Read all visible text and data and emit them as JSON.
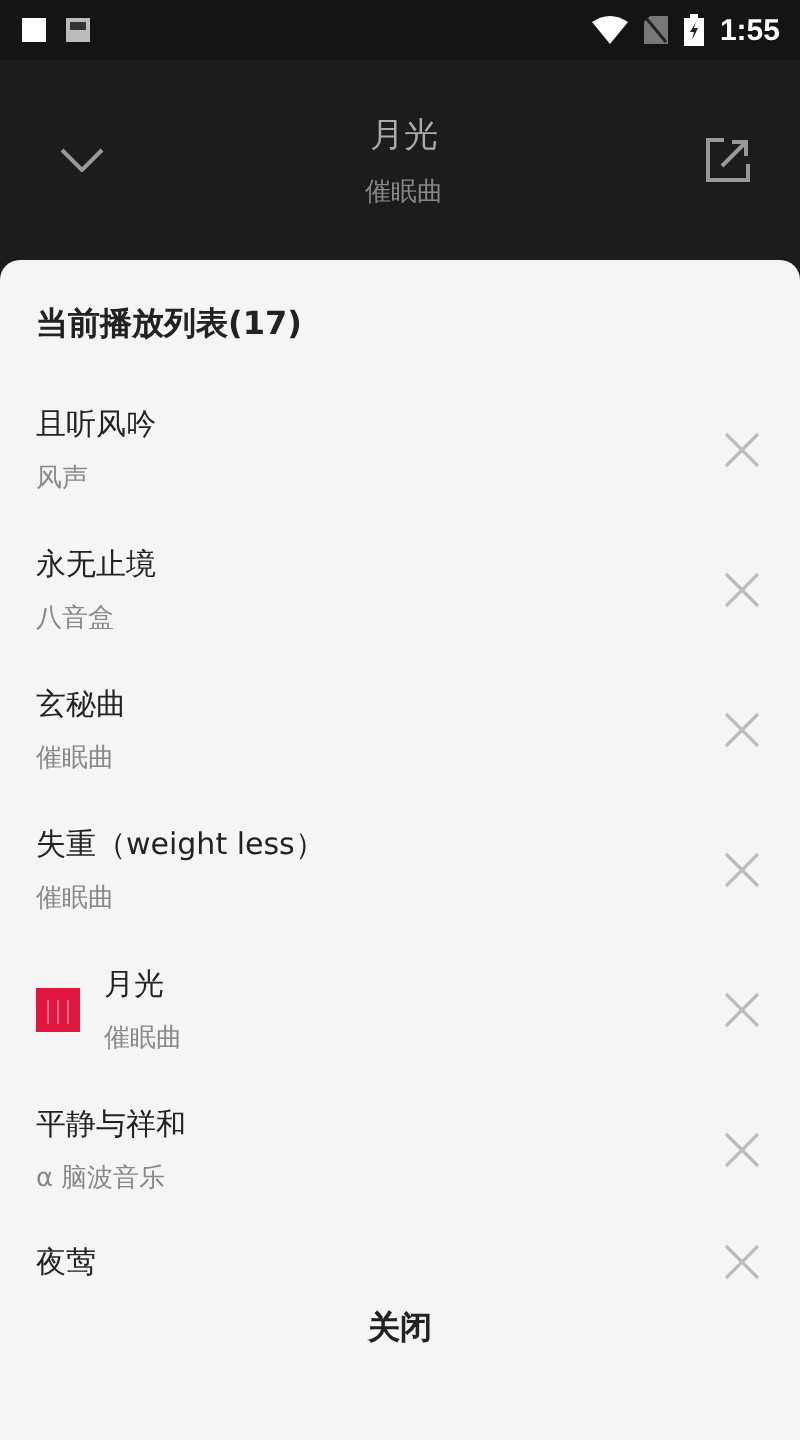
{
  "status_bar": {
    "time": "1:55"
  },
  "header": {
    "title": "月光",
    "subtitle": "催眠曲"
  },
  "playlist": {
    "title": "当前播放列表(17)",
    "items": [
      {
        "title": "且听风吟",
        "artist": "风声",
        "playing": false
      },
      {
        "title": "永无止境",
        "artist": "八音盒",
        "playing": false
      },
      {
        "title": "玄秘曲",
        "artist": "催眠曲",
        "playing": false
      },
      {
        "title": "失重（weight less）",
        "artist": "催眠曲",
        "playing": false
      },
      {
        "title": "月光",
        "artist": "催眠曲",
        "playing": true
      },
      {
        "title": "平静与祥和",
        "artist": "α 脑波音乐",
        "playing": false
      },
      {
        "title": "夜莺",
        "playing": false
      }
    ],
    "close_button": "关闭"
  }
}
